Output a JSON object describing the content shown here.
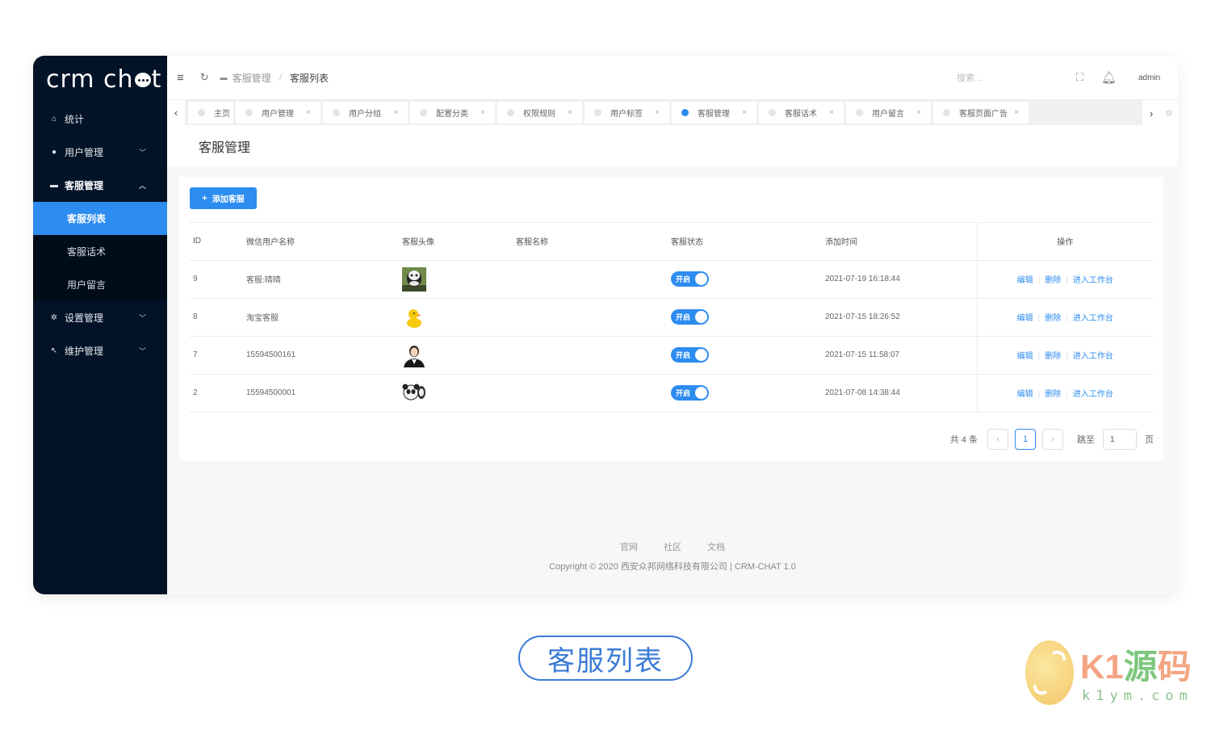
{
  "app": {
    "logo": "crm chat"
  },
  "sidebar": {
    "items": [
      {
        "label": "统计",
        "icon": "home-icon"
      },
      {
        "label": "用户管理",
        "icon": "user-icon"
      },
      {
        "label": "客服管理",
        "icon": "chat-icon"
      },
      {
        "label": "设置管理",
        "icon": "gear-icon"
      },
      {
        "label": "维护管理",
        "icon": "wrench-icon"
      }
    ],
    "sub_items": [
      {
        "label": "客服列表",
        "active": true
      },
      {
        "label": "客服话术"
      },
      {
        "label": "用户留言"
      }
    ]
  },
  "topbar": {
    "breadcrumb": [
      "客服管理",
      "客服列表"
    ],
    "search_placeholder": "搜索...",
    "user": "admin"
  },
  "tabs": [
    {
      "label": "主页"
    },
    {
      "label": "用户管理"
    },
    {
      "label": "用户分组"
    },
    {
      "label": "配置分类"
    },
    {
      "label": "权限规则"
    },
    {
      "label": "用户标签"
    },
    {
      "label": "客服管理",
      "active": true
    },
    {
      "label": "客服话术"
    },
    {
      "label": "用户留言"
    },
    {
      "label": "客服页面广告"
    }
  ],
  "page": {
    "title": "客服管理",
    "add_button": "添加客服"
  },
  "table": {
    "columns": [
      "ID",
      "微信用户名称",
      "客服头像",
      "客服名称",
      "客服状态",
      "添加时间",
      "操作"
    ],
    "rows": [
      {
        "id": "9",
        "wechat_name": "客服:晴晴",
        "avatar": "panda-meme",
        "name": "",
        "status": "开启",
        "time": "2021-07-19 16:18:44"
      },
      {
        "id": "8",
        "wechat_name": "淘宝客服",
        "avatar": "rubber-duck",
        "name": "",
        "status": "开启",
        "time": "2021-07-15 18:26:52"
      },
      {
        "id": "7",
        "wechat_name": "15594500161",
        "avatar": "woman-portrait",
        "name": "",
        "status": "开启",
        "time": "2021-07-15 11:58:07"
      },
      {
        "id": "2",
        "wechat_name": "15594500001",
        "avatar": "panda-faces",
        "name": "",
        "status": "开启",
        "time": "2021-07-08 14:38:44"
      }
    ],
    "actions": [
      "编辑",
      "删除",
      "进入工作台"
    ]
  },
  "pagination": {
    "total_text": "共 4 条",
    "current_page": "1",
    "jump_label": "跳至",
    "jump_value": "1",
    "page_unit": "页"
  },
  "footer": {
    "links": [
      "官网",
      "社区",
      "文档"
    ],
    "copyright": "Copyright © 2020 西安众邦网络科技有限公司 | CRM-CHAT 1.0"
  },
  "caption": "客服列表",
  "watermark": {
    "k": "K1",
    "y": "源",
    "m": "码",
    "url": "k1ym.com"
  },
  "colors": {
    "primary": "#2d8cf0",
    "sidebar_bg": "#021227"
  }
}
